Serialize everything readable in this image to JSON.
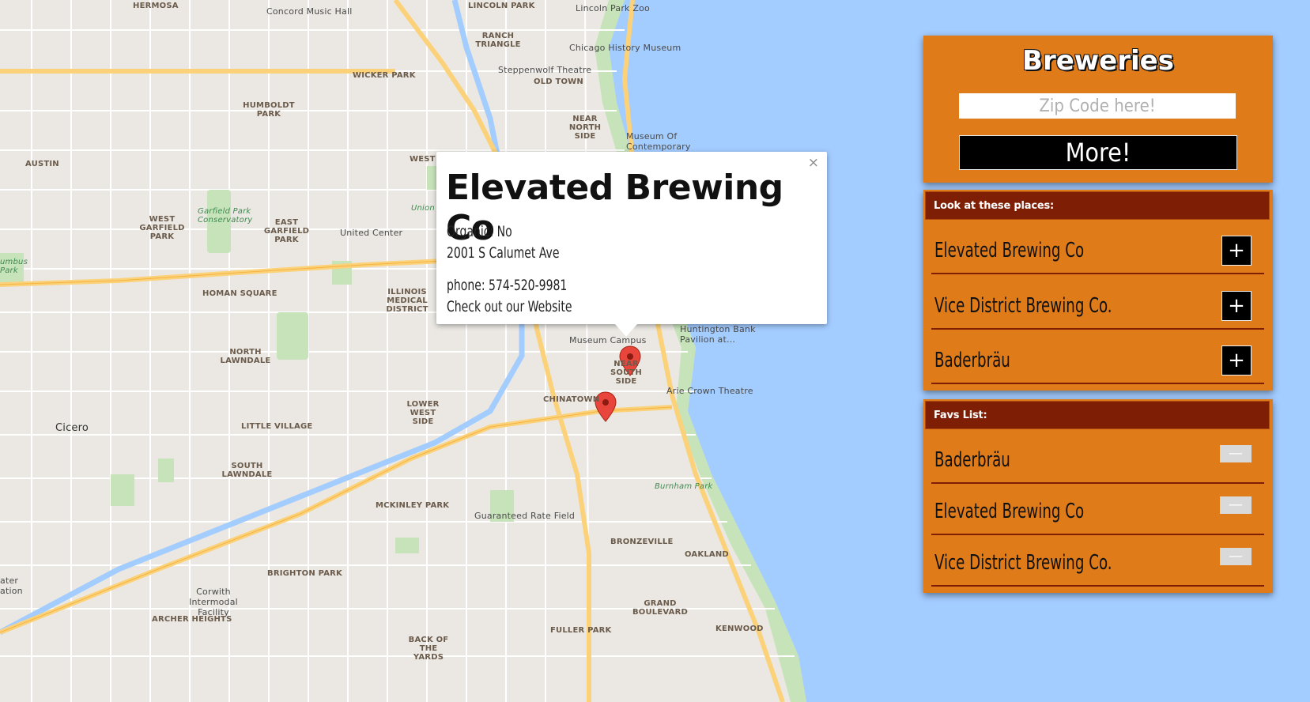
{
  "map": {
    "labels": {
      "hermosa": "HERMOSA",
      "concord": "Concord Music Hall",
      "lincoln_park": "LINCOLN PARK",
      "lincoln_zoo": "Lincoln Park Zoo",
      "chicago_history": "Chicago History Museum",
      "ranch_triangle": "RANCH TRIANGLE",
      "steppenwolf": "Steppenwolf Theatre",
      "old_town": "OLD TOWN",
      "wicker_park": "WICKER PARK",
      "humboldt_park": "HUMBOLDT PARK",
      "near_north": "NEAR NORTH SIDE",
      "mca": "Museum Of Contemporary Art...",
      "austin": "AUSTIN",
      "west_town": "WEST TOWN",
      "union_park": "Union Park",
      "united_center": "United Center",
      "garfield_cons": "Garfield Park Conservatory",
      "west_garfield": "WEST GARFIELD PARK",
      "east_garfield": "EAST GARFIELD PARK",
      "columbus_park": "umbus Park",
      "homan_square": "HOMAN SQUARE",
      "illinois_medical": "ILLINOIS MEDICAL DISTRICT",
      "north_lawndale": "NORTH LAWNDALE",
      "museum_campus": "Museum Campus",
      "huntington": "Huntington Bank Pavilion at...",
      "near_south": "NEAR SOUTH SIDE",
      "arie_crown": "Arie Crown Theatre",
      "chinatown": "CHINATOWN",
      "lower_west": "LOWER WEST SIDE",
      "cicero": "Cicero",
      "little_village": "LITTLE VILLAGE",
      "south_lawndale": "SOUTH LAWNDALE",
      "mckinley_park": "MCKINLEY PARK",
      "guaranteed_rate": "Guaranteed Rate Field",
      "burnham_park": "Burnham Park",
      "bronzeville": "BRONZEVILLE",
      "oakland": "OAKLAND",
      "brighton_park": "BRIGHTON PARK",
      "corwith": "Corwith Intermodal Facility",
      "archer_heights": "ARCHER HEIGHTS",
      "grand_boulevard": "GRAND BOULEVARD",
      "kenwood": "KENWOOD",
      "back_of_yards": "BACK OF THE YARDS",
      "fuller_park": "FULLER PARK",
      "ater_ation": "ater ation"
    }
  },
  "infowindow": {
    "close": "×",
    "title": "Elevated Brewing Co",
    "organic": "Organic: No",
    "address": "2001 S Calumet Ave",
    "phone": "phone: 574-520-9981",
    "website": "Check out our Website"
  },
  "sidebar": {
    "title": "Breweries",
    "zip_placeholder": "Zip Code here!",
    "more_label": "More!",
    "places_header": "Look at these places:",
    "places": [
      {
        "name": "Elevated Brewing Co",
        "action": "+"
      },
      {
        "name": "Vice District Brewing Co.",
        "action": "+"
      },
      {
        "name": "Baderbräu",
        "action": "+"
      }
    ],
    "favs_header": "Favs List:",
    "favs": [
      {
        "name": "Baderbräu",
        "action": "—"
      },
      {
        "name": "Elevated Brewing Co",
        "action": "—"
      },
      {
        "name": "Vice District Brewing Co.",
        "action": "—"
      }
    ]
  }
}
